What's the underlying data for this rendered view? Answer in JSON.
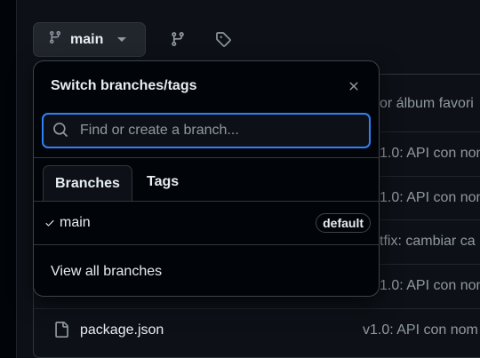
{
  "toolbar": {
    "branch_label": "main",
    "icons": [
      "git-branch-icon",
      "caret-down-icon",
      "branches-icon",
      "tag-icon"
    ]
  },
  "files": {
    "rows": [
      {
        "name": "",
        "message": "or álbum favori"
      },
      {
        "name": "",
        "message": "1.0: API con nom"
      },
      {
        "name": "",
        "message": "1.0: API con nom"
      },
      {
        "name": "",
        "message": "tfix: cambiar ca"
      },
      {
        "name": "",
        "message": "1.0: API con nom"
      },
      {
        "name": "package.json",
        "message": "v1.0: API con nom"
      }
    ]
  },
  "dropdown": {
    "title": "Switch branches/tags",
    "search_placeholder": "Find or create a branch...",
    "tabs": [
      {
        "label": "Branches",
        "selected": true
      },
      {
        "label": "Tags",
        "selected": false
      }
    ],
    "branches": [
      {
        "name": "main",
        "badge": "default",
        "checked": true
      }
    ],
    "view_all": "View all branches"
  },
  "colors": {
    "accent": "#2f81f7",
    "background": "#0d1117",
    "overlay": "#010409"
  }
}
